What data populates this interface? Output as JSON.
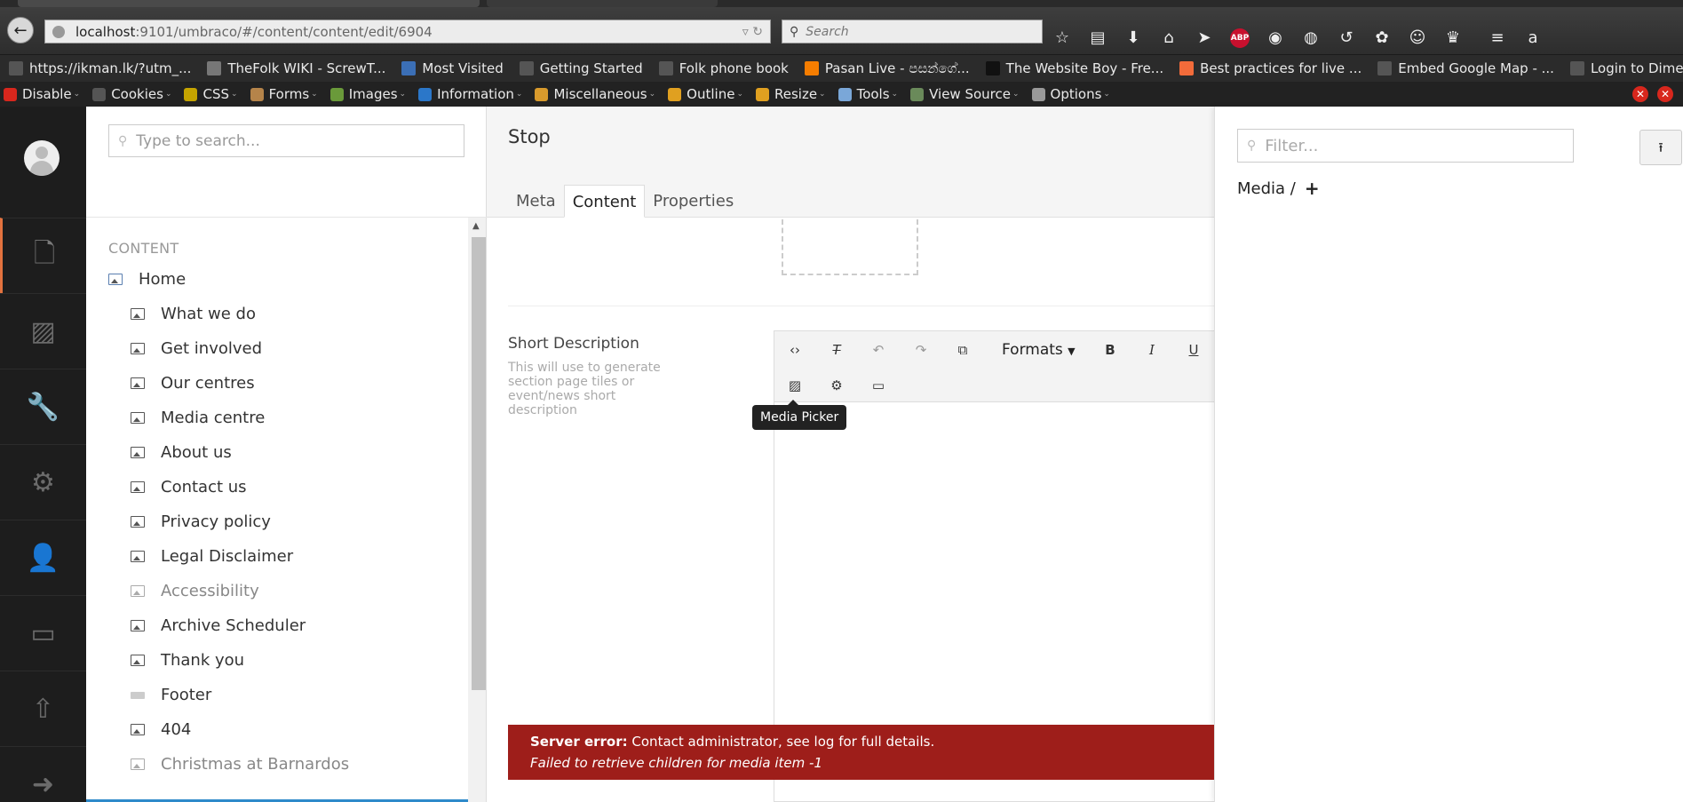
{
  "browser": {
    "url_host": "localhost",
    "url_rest": ":9101/umbraco/#/content/content/edit/6904",
    "search_placeholder": "Search",
    "bookmarks": [
      {
        "label": "https://ikman.lk/?utm_...",
        "icon": "page-icon",
        "color": "#555"
      },
      {
        "label": "TheFolk WIKI - ScrewT...",
        "icon": "wiki-icon",
        "color": "#777"
      },
      {
        "label": "Most Visited",
        "icon": "folder-icon",
        "color": "#3b6fb6"
      },
      {
        "label": "Getting Started",
        "icon": "page-icon",
        "color": "#555"
      },
      {
        "label": "Folk phone book",
        "icon": "page-icon",
        "color": "#555"
      },
      {
        "label": "Pasan Live - පසන්ගේ...",
        "icon": "blogger-icon",
        "color": "#f57d00"
      },
      {
        "label": "The Website Boy - Fre...",
        "icon": "g-icon",
        "color": "#111"
      },
      {
        "label": "Best practices for live ...",
        "icon": "site-icon",
        "color": "#f26b3a"
      },
      {
        "label": "Embed Google Map - ...",
        "icon": "page-icon",
        "color": "#555"
      },
      {
        "label": "Login to Dimension D...",
        "icon": "page-icon",
        "color": "#555"
      }
    ],
    "webdev_tools": [
      {
        "label": "Disable",
        "icon": "disable-icon",
        "color": "#d8271d"
      },
      {
        "label": "Cookies",
        "icon": "cookie-icon",
        "color": "#555"
      },
      {
        "label": "CSS",
        "icon": "css-icon",
        "color": "#c5a400"
      },
      {
        "label": "Forms",
        "icon": "forms-icon",
        "color": "#b5844a"
      },
      {
        "label": "Images",
        "icon": "images-icon",
        "color": "#6a9a3a"
      },
      {
        "label": "Information",
        "icon": "info-icon",
        "color": "#2b77c9"
      },
      {
        "label": "Miscellaneous",
        "icon": "misc-icon",
        "color": "#d89a2c"
      },
      {
        "label": "Outline",
        "icon": "outline-icon",
        "color": "#e0a020"
      },
      {
        "label": "Resize",
        "icon": "resize-icon",
        "color": "#e0a020"
      },
      {
        "label": "Tools",
        "icon": "tools-icon",
        "color": "#7aa7d8"
      },
      {
        "label": "View Source",
        "icon": "source-icon",
        "color": "#6a8a5a"
      },
      {
        "label": "Options",
        "icon": "options-icon",
        "color": "#999"
      }
    ]
  },
  "tree": {
    "search_placeholder": "Type to search...",
    "header": "CONTENT",
    "items": [
      {
        "label": "Home",
        "level": 0,
        "style": "home"
      },
      {
        "label": "What we do",
        "level": 1,
        "style": "normal"
      },
      {
        "label": "Get involved",
        "level": 1,
        "style": "normal"
      },
      {
        "label": "Our centres",
        "level": 1,
        "style": "normal"
      },
      {
        "label": "Media centre",
        "level": 1,
        "style": "normal"
      },
      {
        "label": "About us",
        "level": 1,
        "style": "normal"
      },
      {
        "label": "Contact us",
        "level": 1,
        "style": "normal"
      },
      {
        "label": "Privacy policy",
        "level": 1,
        "style": "normal"
      },
      {
        "label": "Legal Disclaimer",
        "level": 1,
        "style": "normal"
      },
      {
        "label": "Accessibility",
        "level": 1,
        "style": "muted"
      },
      {
        "label": "Archive Scheduler",
        "level": 1,
        "style": "normal"
      },
      {
        "label": "Thank you",
        "level": 1,
        "style": "normal"
      },
      {
        "label": "Footer",
        "level": 1,
        "style": "footer"
      },
      {
        "label": "404",
        "level": 1,
        "style": "normal"
      },
      {
        "label": "Christmas at Barnardos",
        "level": 1,
        "style": "muted"
      }
    ]
  },
  "editor": {
    "title": "Stop",
    "tabs": [
      {
        "label": "Meta",
        "active": false
      },
      {
        "label": "Content",
        "active": true
      },
      {
        "label": "Properties",
        "active": false
      }
    ],
    "property_label": "Short Description",
    "property_description": "This will use to generate section page tiles or event/news short description",
    "rte_formats": "Formats",
    "tooltip": "Media Picker"
  },
  "error": {
    "title": "Server error:",
    "message": "Contact administrator, see log for full details.",
    "detail": "Failed to retrieve children for media item -1"
  },
  "media_panel": {
    "filter_placeholder": "Filter...",
    "breadcrumb": "Media /",
    "add_label": "+"
  }
}
